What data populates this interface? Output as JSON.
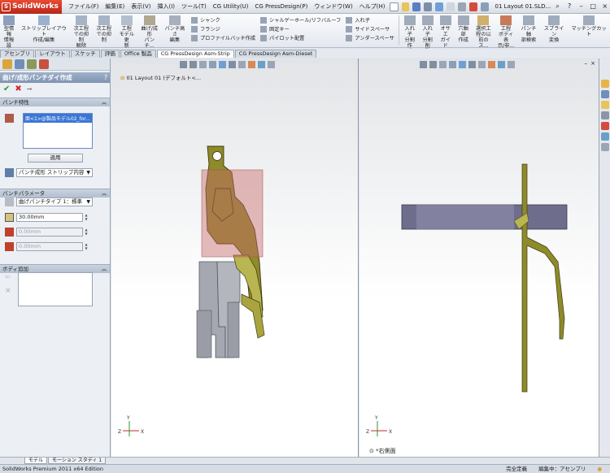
{
  "app": {
    "logo": "SolidWorks",
    "doc_title": "01 Layout 01.SLD..."
  },
  "menu": [
    "ファイル(F)",
    "編集(E)",
    "表示(V)",
    "挿入(I)",
    "ツール(T)",
    "CG Utility(U)",
    "CG PressDesign(P)",
    "ウィンドウ(W)",
    "ヘルプ(H)"
  ],
  "ribbon": {
    "big_left": [
      "型情報\n情報設\n定",
      "ストリップレイアウト\n作成/編集",
      "次工程\nでの抑制\n解除",
      "次工程\nでの抑制",
      "工程\nモデル更\n新",
      "曲げ/成\n形\nパンチ...",
      "パンチ高さ\n編集"
    ],
    "col1": [
      "シャンク",
      "フランジ",
      "プロファイルバッチ作成"
    ],
    "col2": [
      "シャルゲーホール/リフバルーフ",
      "固定キー",
      "パイロット配置"
    ],
    "col3": [
      "入れ子",
      "サイドスペーサ",
      "アンダースペーサ"
    ],
    "big_right": [
      "入れ子\n分割作\n成",
      "入れ子\n分割削\n除",
      "オサエ\nガイド",
      "穴軸部\n作成",
      "選択工\n程の以\n前のス...",
      "工程\nボディ表\n示/非...",
      "パンチ軸\n部検索",
      "スプライン\n変換",
      "マッチングカット"
    ]
  },
  "tabs": [
    "アセンブリ",
    "レイアウト",
    "スケッチ",
    "評価",
    "Office 製品",
    "CG PressDesign Asm-Strip",
    "CG PressDesign Asm-Dieset"
  ],
  "property_manager": {
    "title": "曲げ/成形パンチダイ作成",
    "help": "?",
    "ok": "✔",
    "cancel": "✖",
    "punch_group": {
      "header": "パンチ特性",
      "selected_item": "面<1>@製品モデル02_for...",
      "apply_button": "適用",
      "type_value": "パンチ成形 ストリップ内容"
    },
    "param_group": {
      "header": "パンチパラメータ",
      "bend_type": "曲げパンチタイプ 1：標準",
      "value1": "30.00mm",
      "value2": "0.00mm",
      "value3": "0.00mm"
    },
    "body_group": {
      "header": "ボディ追加"
    }
  },
  "viewport_left": {
    "tree_text": "01 Layout 01  (デフォルト<..."
  },
  "viewport_right": {
    "caption": "*右側面"
  },
  "bottom_tabs": [
    "モデル",
    "モーション スタディ 1"
  ],
  "status": {
    "left": "SolidWorks Premium 2011 x64 Edition",
    "state": "完全定義",
    "editing": "編集中：アセンブリ"
  },
  "colors": {
    "part": "#8f8a2a",
    "part_light": "#b9b551",
    "die_grey": "#a5a8b0",
    "overlay": "#c86a6a",
    "block": "#6e6e8c"
  }
}
